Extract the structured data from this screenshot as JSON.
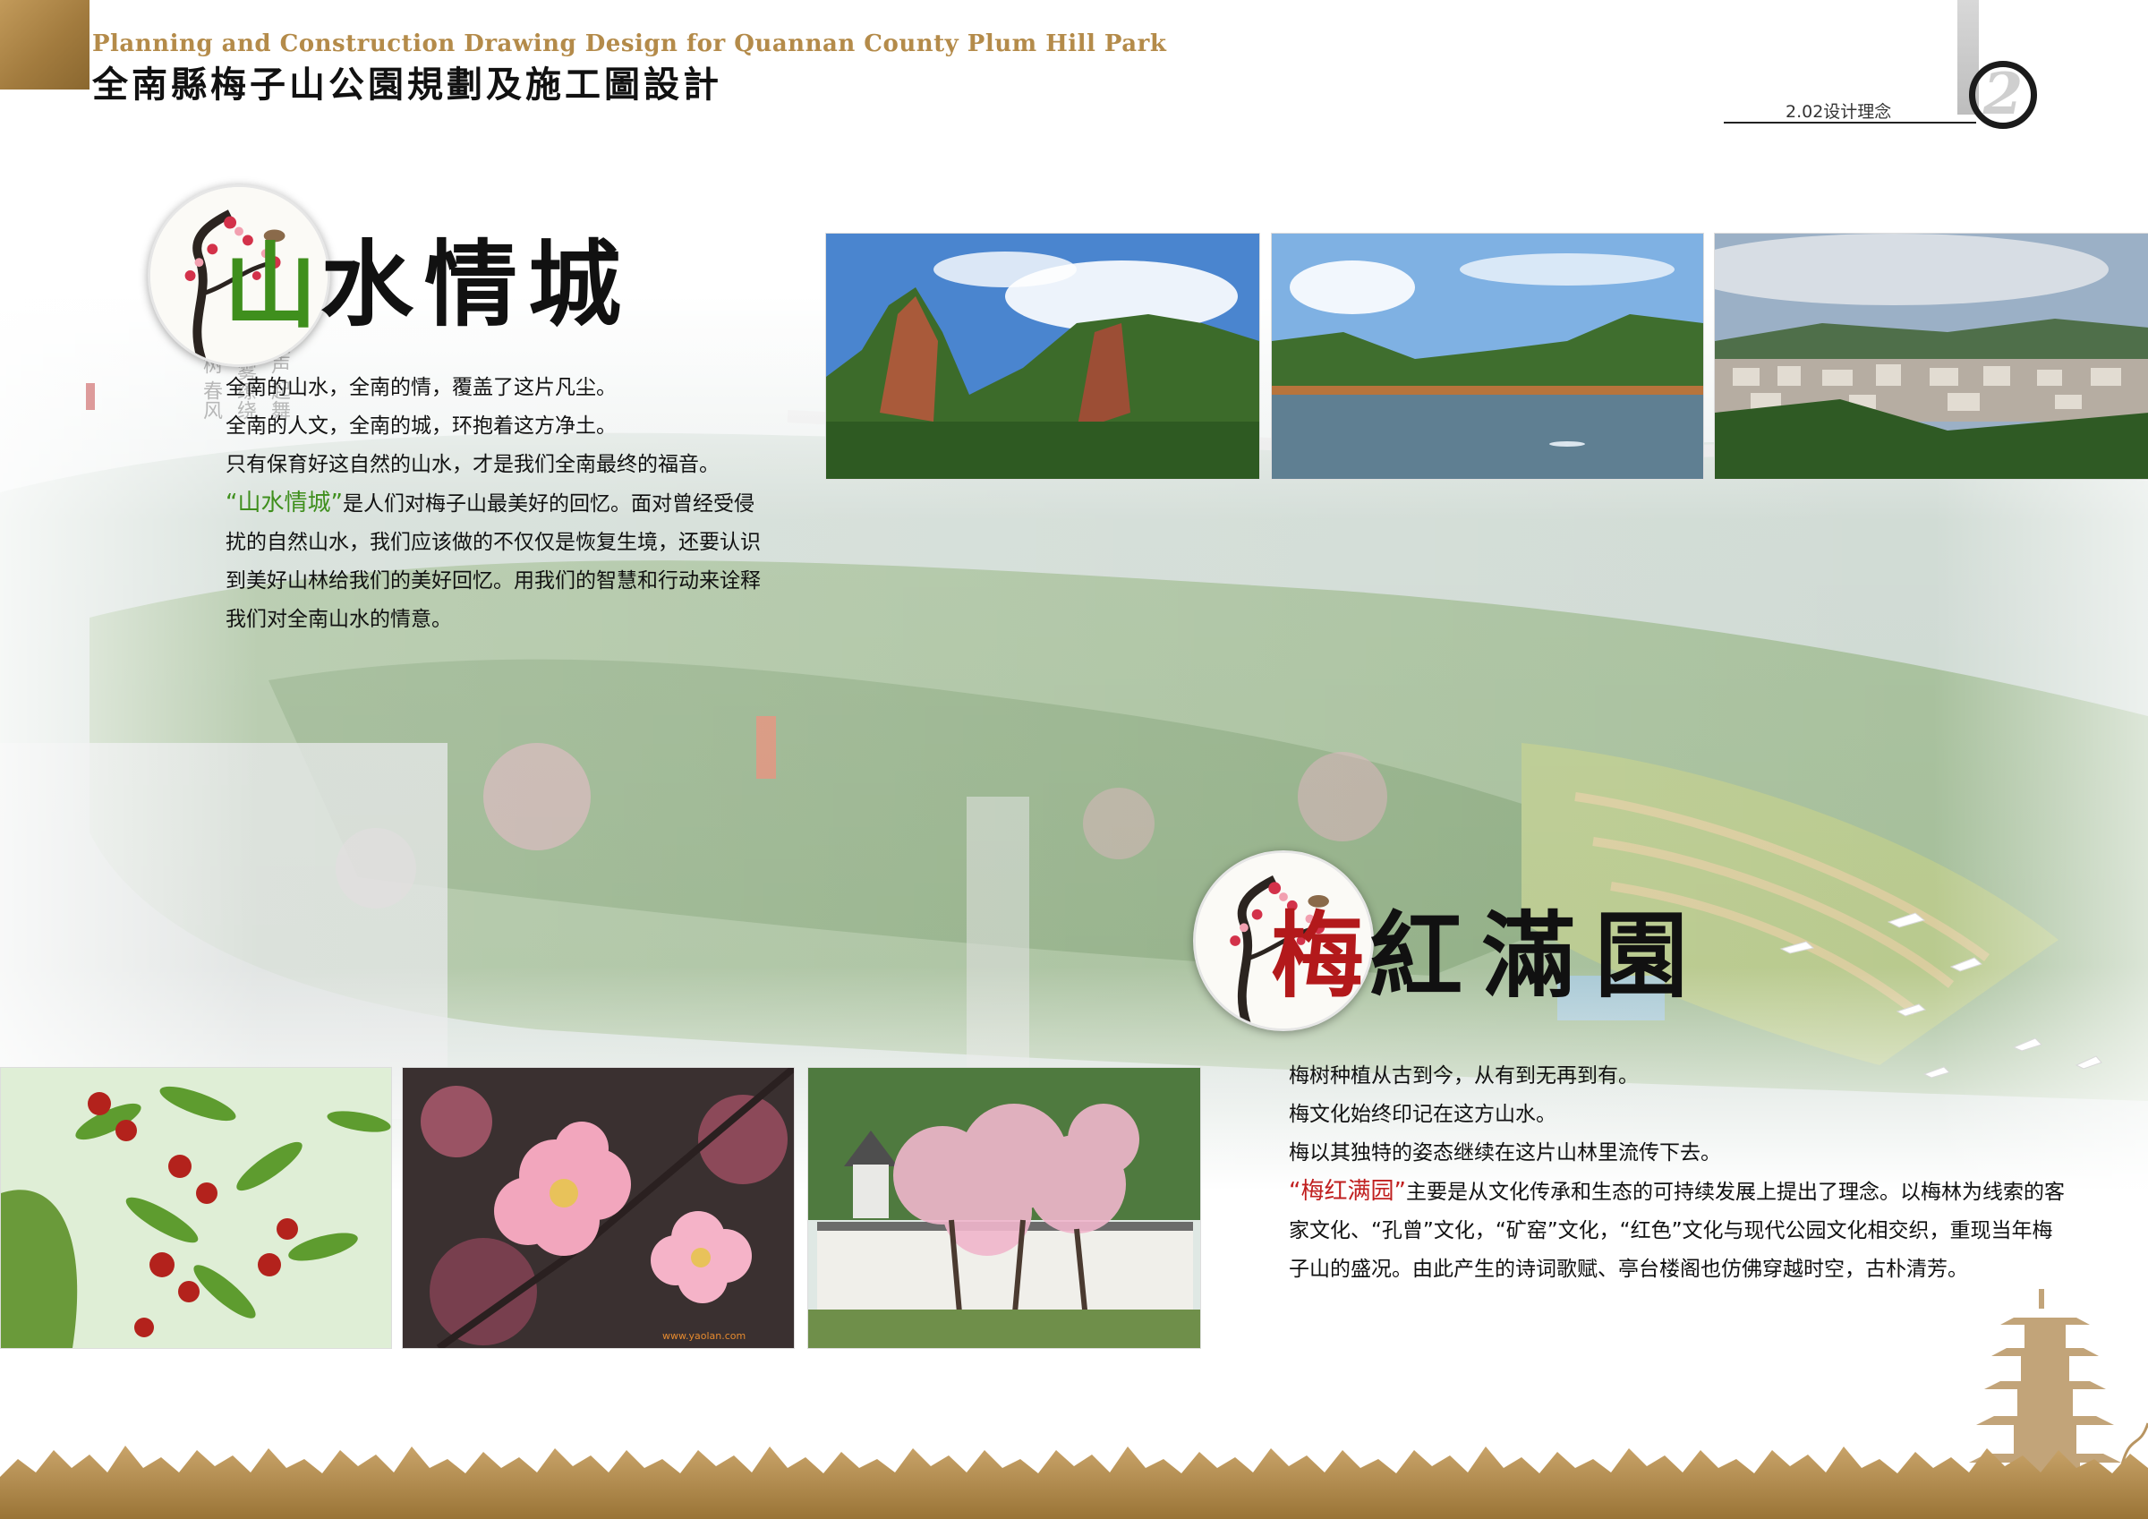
{
  "header": {
    "title_en": "Planning and Construction Drawing Design for Quannan County Plum Hill Park",
    "title_zh": "全南縣梅子山公園規劃及施工圖設計",
    "section_label": "2.02设计理念",
    "page_number": "2"
  },
  "section1": {
    "heading_first": "山",
    "heading_rest": "水情城",
    "poem_lines": [
      "塔影泉声",
      "起舞吟诗",
      "云雾缭绕",
      "红花绿树",
      "春风骀荡"
    ],
    "lines": [
      "全南的山水，全南的情，覆盖了这片凡尘。",
      "全南的人文，全南的城，环抱着这方净土。",
      "只有保育好这自然的山水，才是我们全南最终的福音。"
    ],
    "highlight": "“山水情城”",
    "body": "是人们对梅子山最美好的回忆。面对曾经受侵扰的自然山水，我们应该做的不仅仅是恢复生境，还要认识到美好山林给我们的美好回忆。用我们的智慧和行动来诠释我们对全南山水的情意。"
  },
  "section2": {
    "heading_first": "梅",
    "heading_rest": "紅滿園",
    "lines": [
      "梅树种植从古到今，从有到无再到有。",
      "梅文化始终印记在这方山水。",
      "梅以其独特的姿态继续在这片山林里流传下去。"
    ],
    "highlight": "“梅红满园”",
    "body": "主要是从文化传承和生态的可持续发展上提出了理念。以梅林为线索的客家文化、“孔曾”文化，“矿窑”文化，“红色”文化与现代公园文化相交织，重现当年梅子山的盛况。由此产生的诗词歌赋、亭台楼阁也仿佛穿越时空，古朴清芳。"
  },
  "photos": {
    "watermark": "www.yaolan.com"
  },
  "colors": {
    "accent_gold": "#b48b4a",
    "green": "#3f8f1d",
    "red": "#c01f1f"
  }
}
